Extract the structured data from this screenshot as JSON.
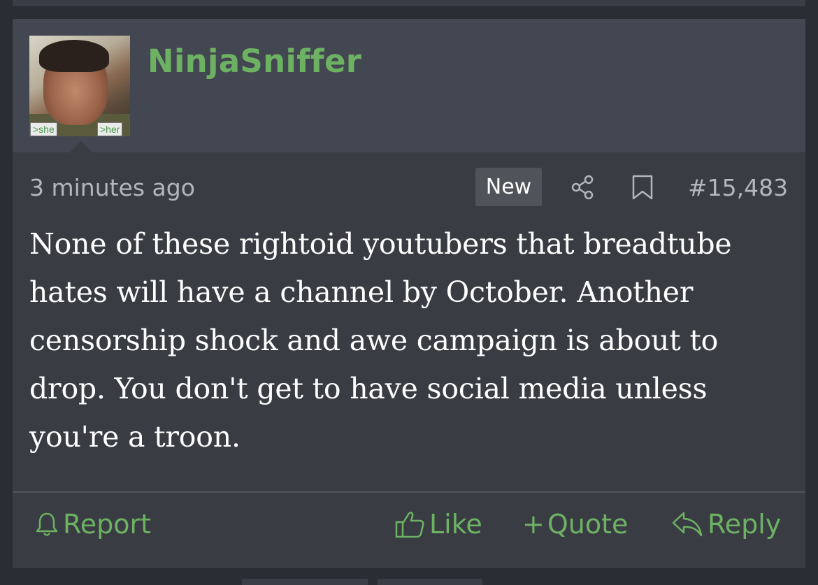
{
  "post": {
    "username": "NinjaSniffer",
    "avatar_tags": {
      "she": ">she",
      "her": ">her"
    },
    "time": "3 minutes ago",
    "badge": "New",
    "post_number": "#15,483",
    "body": "None of these rightoid youtubers that breadtube hates will have a channel by October. Another censorship shock and awe campaign is about to drop. You don't get to have social media unless you're a troon.",
    "icons": {
      "share": "share-icon",
      "bookmark": "bookmark-icon"
    }
  },
  "footer": {
    "report": "Report",
    "like": "Like",
    "quote": "Quote",
    "reply": "Reply"
  },
  "colors": {
    "accent": "#6db263",
    "post_bg": "#393c43",
    "header_bg": "#434751",
    "page_bg": "#2a2d33"
  }
}
